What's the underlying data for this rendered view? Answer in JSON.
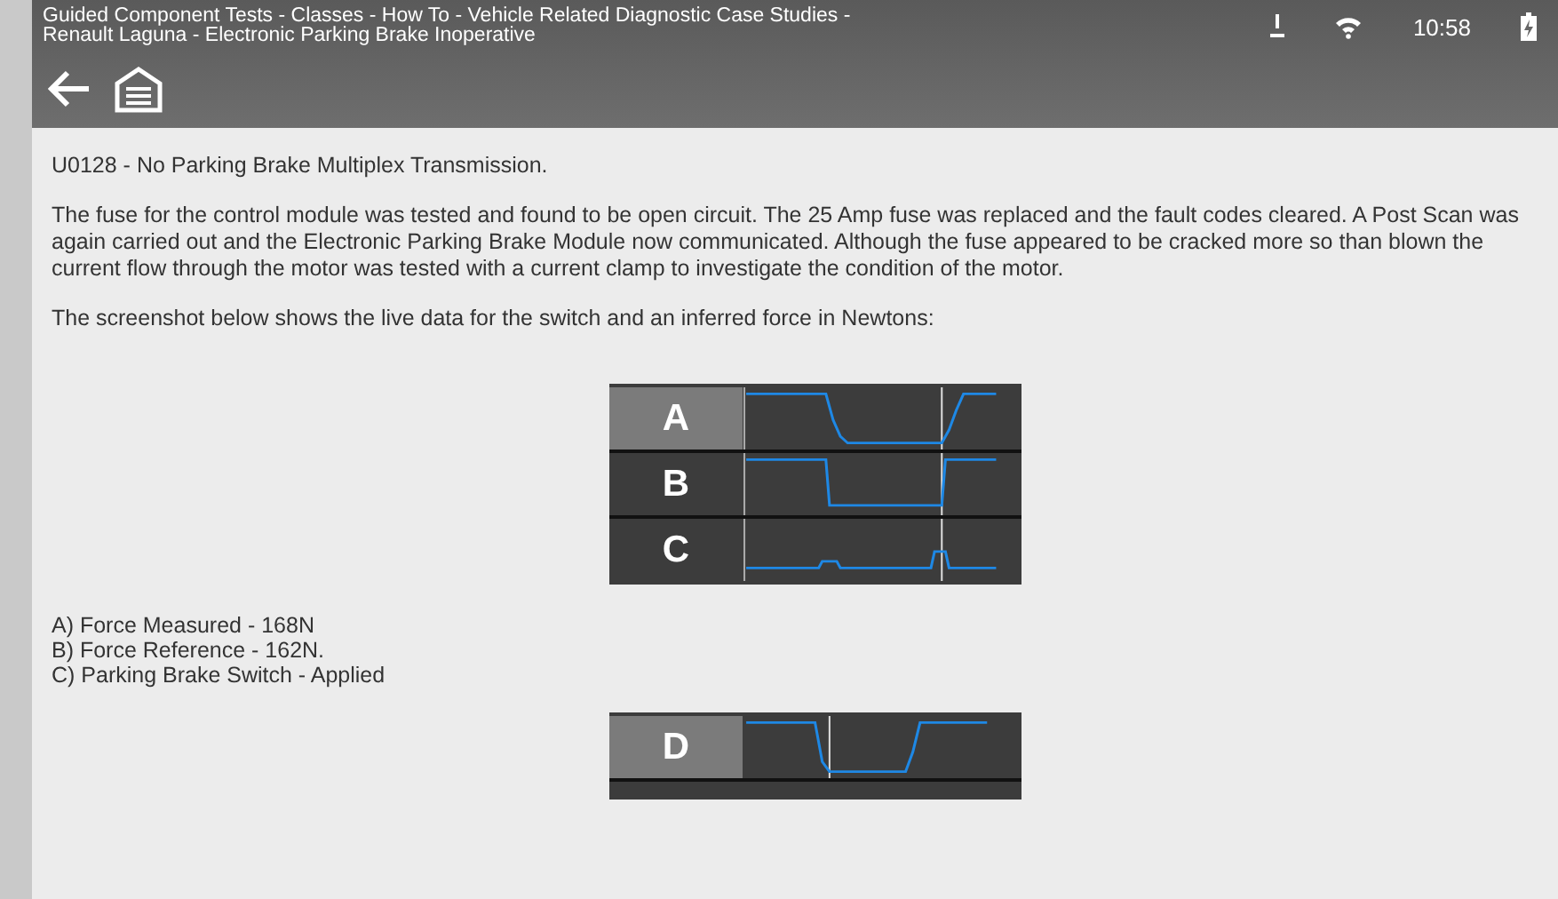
{
  "header": {
    "title": "Guided Component Tests - Classes - How To - Vehicle Related Diagnostic Case Studies - Renault Laguna - Electronic Parking Brake Inoperative",
    "time": "10:58"
  },
  "paragraphs": [
    "U0128 - No Parking Brake Multiplex Transmission.",
    "The fuse for the control module was tested and found to be open circuit. The 25 Amp fuse was replaced and the fault codes cleared. A Post Scan was again carried out and the Electronic Parking Brake Module now communicated. Although the fuse appeared to be cracked more so than blown the current flow through the motor was tested with a current clamp to investigate the condition of the motor.",
    "The screenshot below shows the live data for the switch and an inferred force in Newtons:"
  ],
  "figure_1": {
    "rows": [
      {
        "label": "A",
        "selected": true
      },
      {
        "label": "B",
        "selected": false
      },
      {
        "label": "C",
        "selected": false
      }
    ]
  },
  "legend": [
    "A) Force Measured - 168N",
    "B) Force Reference - 162N.",
    "C) Parking Brake Switch - Applied"
  ],
  "figure_2": {
    "rows": [
      {
        "label": "D",
        "selected": true
      }
    ]
  }
}
